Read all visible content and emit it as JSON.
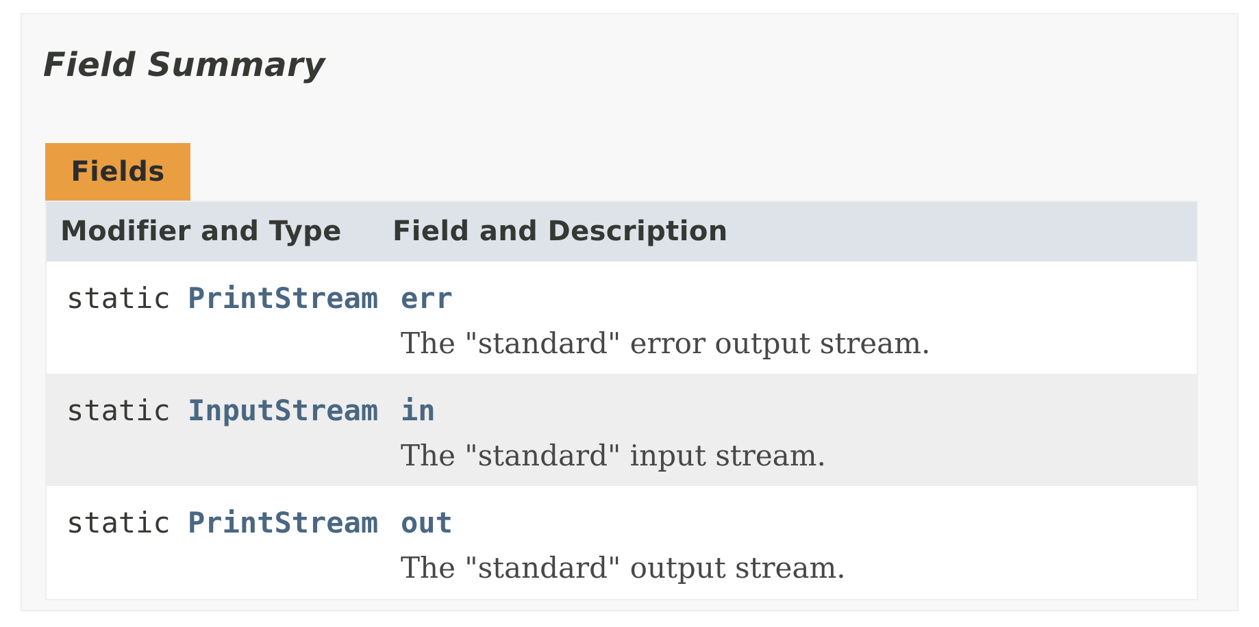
{
  "summary": {
    "title": "Field Summary",
    "caption": "Fields",
    "columns": [
      "Modifier and Type",
      "Field and Description"
    ],
    "rows": [
      {
        "modifier": "static",
        "type": "PrintStream",
        "name": "err",
        "description": "The \"standard\" error output stream."
      },
      {
        "modifier": "static",
        "type": "InputStream",
        "name": "in",
        "description": "The \"standard\" input stream."
      },
      {
        "modifier": "static",
        "type": "PrintStream",
        "name": "out",
        "description": "The \"standard\" output stream."
      }
    ]
  },
  "colors": {
    "caption_tab": "#e99e42",
    "header_bg": "#dee3e9",
    "alt_row_bg": "#eeeeee",
    "link": "#4a6782"
  }
}
